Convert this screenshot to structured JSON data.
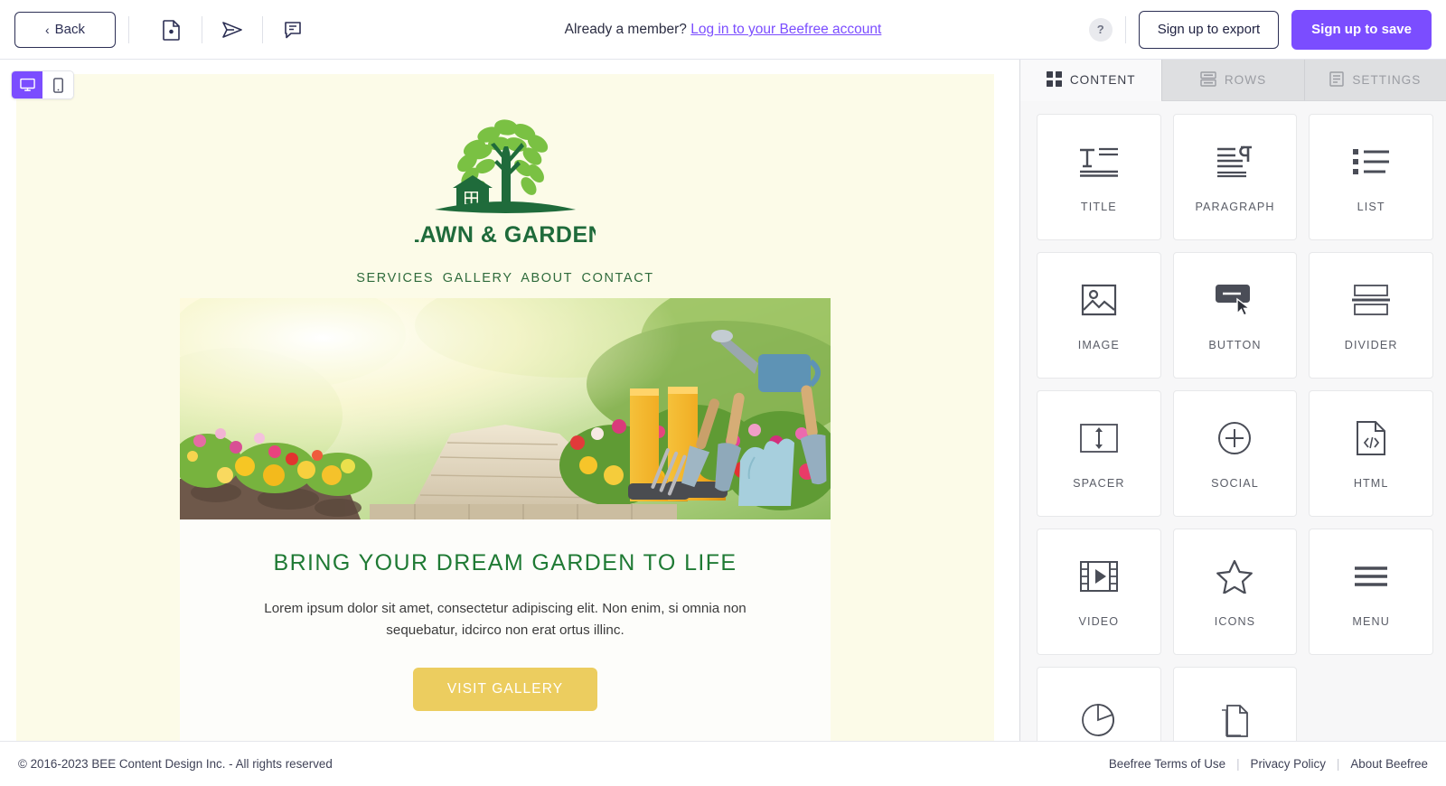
{
  "topbar": {
    "back_label": "Back",
    "back_chevron": "‹",
    "icons": [
      {
        "name": "file-preview-icon"
      },
      {
        "name": "send-test-icon"
      },
      {
        "name": "comment-icon"
      }
    ],
    "member_prompt": "Already a member?",
    "member_link": "Log in to your Beefree account",
    "help_label": "?",
    "export_label": "Sign up to export",
    "save_label": "Sign up to save",
    "accent_purple": "#7b4dff",
    "link_purple": "#7b4dff"
  },
  "device_toggle": {
    "desktop": "desktop",
    "mobile": "mobile",
    "active": "desktop"
  },
  "email": {
    "background": "#fcfbe8",
    "content_background": "#fdfdfa",
    "logo": {
      "wordmark": "LAWN & GARDEN",
      "leaf_color": "#7ac143",
      "trunk_color": "#1f6b3b"
    },
    "nav": [
      "SERVICES",
      "GALLERY",
      "ABOUT",
      "CONTACT"
    ],
    "nav_color": "#2f6b3c",
    "hero_alt": "garden-path-with-flowers-boots-and-tools",
    "headline": "BRING YOUR DREAM GARDEN TO LIFE",
    "headline_color": "#1f7a34",
    "paragraph": "Lorem ipsum dolor sit amet, consectetur adipiscing elit. Non enim, si omnia non sequebatur, idcirco non erat ortus illinc.",
    "cta_label": "VISIT GALLERY",
    "cta_color": "#eccd5f"
  },
  "sidebar": {
    "tabs": [
      {
        "label": "CONTENT",
        "icon": "grid-icon",
        "active": true
      },
      {
        "label": "ROWS",
        "icon": "rows-icon",
        "active": false
      },
      {
        "label": "SETTINGS",
        "icon": "settings-doc-icon",
        "active": false
      }
    ],
    "tiles": [
      {
        "label": "TITLE",
        "icon": "title-icon"
      },
      {
        "label": "PARAGRAPH",
        "icon": "paragraph-icon"
      },
      {
        "label": "LIST",
        "icon": "list-icon"
      },
      {
        "label": "IMAGE",
        "icon": "image-icon"
      },
      {
        "label": "BUTTON",
        "icon": "button-icon"
      },
      {
        "label": "DIVIDER",
        "icon": "divider-icon"
      },
      {
        "label": "SPACER",
        "icon": "spacer-icon"
      },
      {
        "label": "SOCIAL",
        "icon": "social-plus-icon"
      },
      {
        "label": "HTML",
        "icon": "html-code-icon"
      },
      {
        "label": "VIDEO",
        "icon": "video-icon"
      },
      {
        "label": "ICONS",
        "icon": "star-icon"
      },
      {
        "label": "MENU",
        "icon": "menu-icon"
      },
      {
        "label": "",
        "icon": "gif-icon"
      },
      {
        "label": "",
        "icon": "paper-stack-icon"
      }
    ]
  },
  "footer": {
    "copyright": "© 2016-2023 BEE Content Design Inc. - All rights reserved",
    "links": [
      "Beefree Terms of Use",
      "Privacy Policy",
      "About Beefree"
    ],
    "separator": "|"
  }
}
